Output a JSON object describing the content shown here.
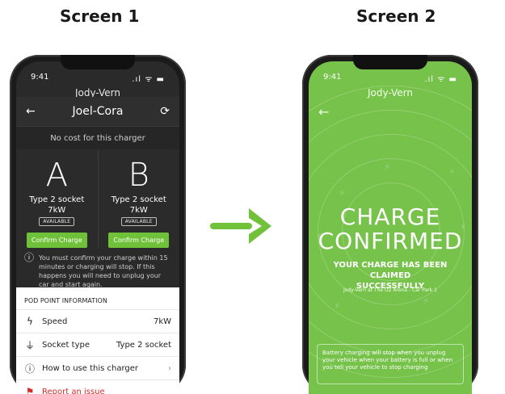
{
  "labels": {
    "screen1": "Screen 1",
    "screen2": "Screen 2"
  },
  "status": {
    "time": "9:41",
    "icons_text": ".ıl ᯤ ▬"
  },
  "screen1": {
    "top_name": "Jody-Vern",
    "header_title": "Joel-Cora",
    "no_cost": "No cost for this charger",
    "sockets": [
      {
        "id": "A",
        "type": "Type 2 socket",
        "power": "7kW",
        "availability": "AVAILABLE",
        "button": "Confirm Charge"
      },
      {
        "id": "B",
        "type": "Type 2 socket",
        "power": "7kW",
        "availability": "AVAILABLE",
        "button": "Confirm Charge"
      }
    ],
    "note": "You must confirm your charge within 15 minutes or charging will stop. If this happens you will need to unplug your car and start again.",
    "section_title": "POD POINT INFORMATION",
    "rows": [
      {
        "label": "Speed",
        "value": "7kW"
      },
      {
        "label": "Socket type",
        "value": "Type 2 socket"
      },
      {
        "label": "How to use this charger",
        "value": "›"
      },
      {
        "label": "Report an issue",
        "value": ""
      }
    ]
  },
  "screen2": {
    "top_name": "Jody-Vern",
    "title_line1": "CHARGE",
    "title_line2": "CONFIRMED",
    "subtitle_line1": "YOUR CHARGE HAS BEEN CLAIMED",
    "subtitle_line2": "SUCCESSFULLY",
    "location": "Jody-Vern at The O2 Arena - Car Park 1",
    "footer": "Battery charging will stop when you unplug your vehicle when your battery is full or when you tell your vehicle to stop charging"
  },
  "colors": {
    "accent_green": "#76c24a",
    "button_green": "#6fc13a",
    "report_red": "#d12e2e",
    "dark_bg": "#2a2a2a"
  },
  "icons": {
    "back": "arrow-left-icon",
    "refresh": "refresh-icon",
    "info": "info-icon",
    "speed": "lightning-icon",
    "socket": "plug-icon",
    "report": "flag-icon",
    "transition": "arrow-right-icon",
    "spark": "lightning-icon"
  }
}
